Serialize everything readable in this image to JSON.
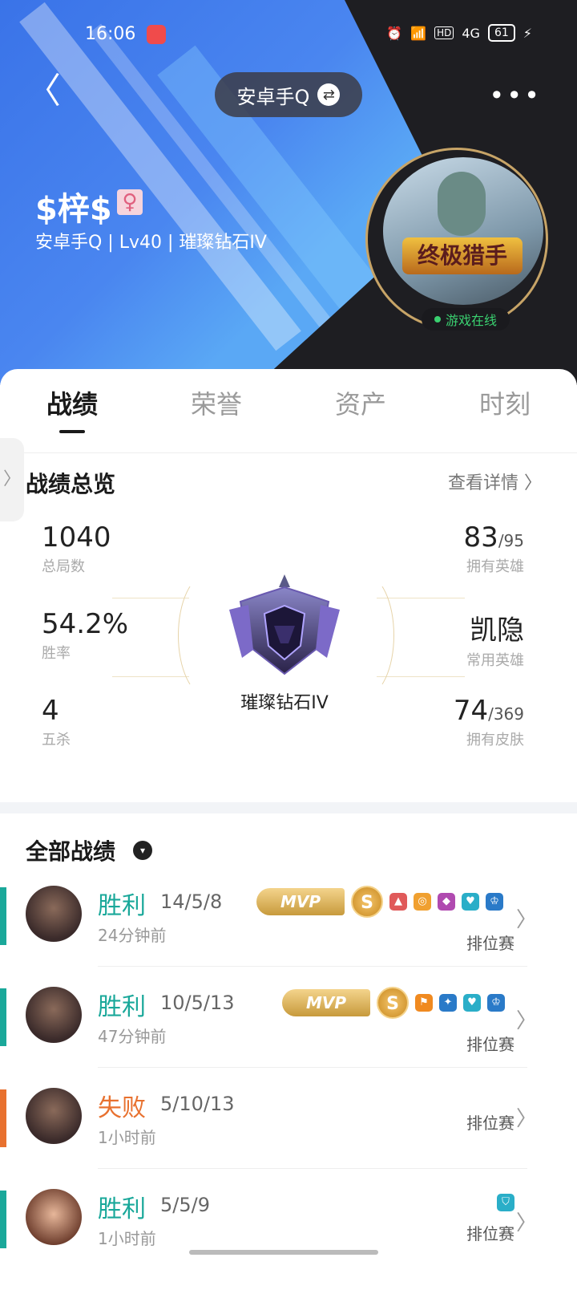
{
  "status_bar": {
    "time": "16:06",
    "battery": "61",
    "hd": "HD",
    "net": "4G"
  },
  "header": {
    "account_pill": "安卓手Q",
    "swap_icon": "⇄",
    "more": "•••",
    "back": "〈"
  },
  "profile": {
    "name": "$梓$",
    "gender_icon": "♀",
    "subinfo": "安卓手Q | Lv40 | 璀璨钻石IV",
    "online_label": "游戏在线",
    "avatar_text": "终极猎手"
  },
  "tabs": [
    {
      "label": "战绩"
    },
    {
      "label": "荣誉"
    },
    {
      "label": "资产"
    },
    {
      "label": "时刻"
    }
  ],
  "overview": {
    "title": "战绩总览",
    "detail_link": "查看详情 〉",
    "total_games": {
      "value": "1040",
      "label": "总局数"
    },
    "win_rate": {
      "value": "54.2%",
      "label": "胜率"
    },
    "penta": {
      "value": "4",
      "label": "五杀"
    },
    "heroes": {
      "value": "83",
      "total": "/95",
      "label": "拥有英雄"
    },
    "common_hero": {
      "value": "凯隐",
      "label": "常用英雄"
    },
    "skins": {
      "value": "74",
      "total": "/369",
      "label": "拥有皮肤"
    },
    "rank": "璀璨钻石IV"
  },
  "all_records": {
    "title": "全部战绩",
    "chevron": "▾"
  },
  "matches": [
    {
      "result": "胜利",
      "kda": "14/5/8",
      "ago": "24分钟前",
      "type": "排位赛",
      "mvp": "MVP",
      "coin": "S",
      "color": "#1aa89a",
      "win": true
    },
    {
      "result": "胜利",
      "kda": "10/5/13",
      "ago": "47分钟前",
      "type": "排位赛",
      "mvp": "MVP",
      "coin": "S",
      "color": "#1aa89a",
      "win": true
    },
    {
      "result": "失败",
      "kda": "5/10/13",
      "ago": "1小时前",
      "type": "排位赛",
      "color": "#e8712f",
      "win": false
    },
    {
      "result": "胜利",
      "kda": "5/5/9",
      "ago": "1小时前",
      "type": "排位赛",
      "color": "#1aa89a",
      "win": true
    }
  ],
  "colors": {
    "win": "#1aa89a",
    "loss": "#e8712f",
    "accent_gold": "#c7a467"
  }
}
